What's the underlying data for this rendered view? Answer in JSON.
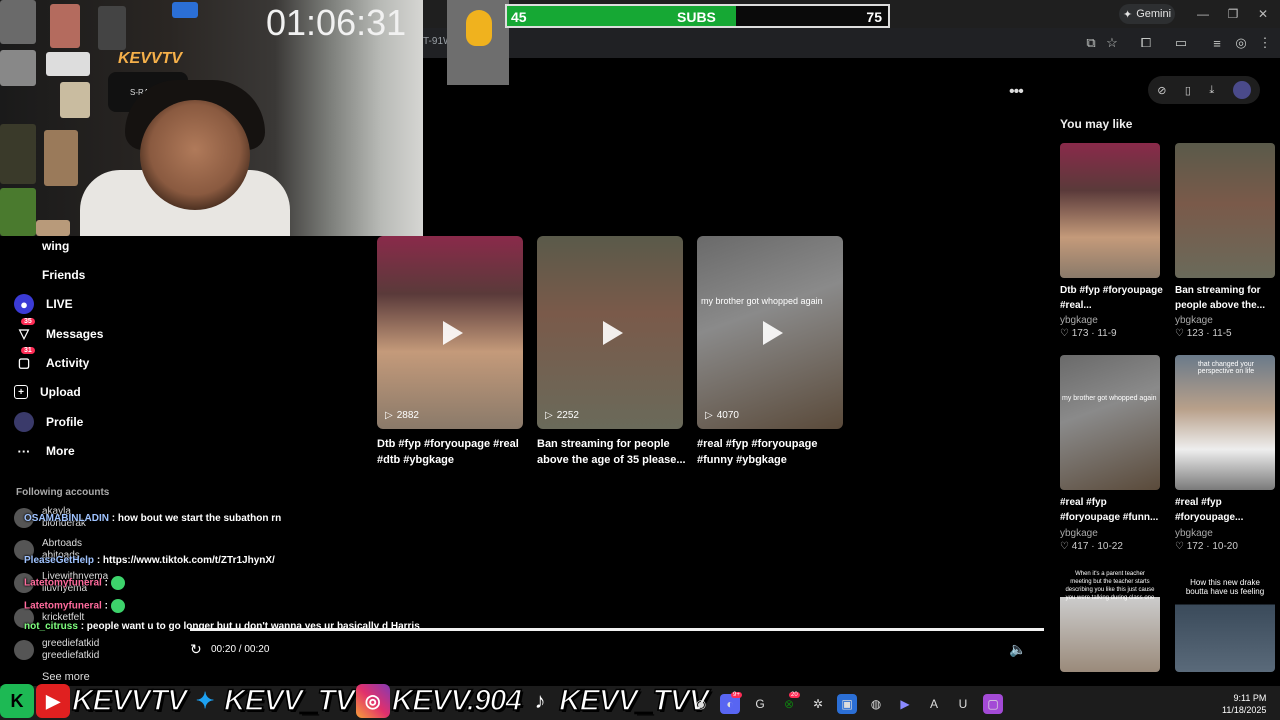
{
  "stream": {
    "timer": "01:06:31",
    "logo_text": "KEVVTV",
    "chair_text": "S-RACER",
    "subs_left": "45",
    "subs_label": "SUBS",
    "subs_right": "75",
    "subs_progress": 0.6
  },
  "browser": {
    "url_fragment": "T-91W",
    "gemini_label": "Gemini"
  },
  "nav": {
    "items": [
      {
        "label": "wing",
        "icon": "following-icon"
      },
      {
        "label": "Friends",
        "icon": "friends-icon"
      },
      {
        "label": "LIVE",
        "icon": "live-icon"
      },
      {
        "label": "Messages",
        "icon": "messages-icon",
        "badge": "35"
      },
      {
        "label": "Activity",
        "icon": "activity-icon",
        "badge": "31"
      },
      {
        "label": "Upload",
        "icon": "upload-icon"
      },
      {
        "label": "Profile",
        "icon": "profile-icon"
      },
      {
        "label": "More",
        "icon": "more-icon"
      }
    ],
    "following_header": "Following accounts",
    "accounts": [
      {
        "top": "akayla",
        "bottom": "blonderak"
      },
      {
        "top": "Abrtoads",
        "bottom": "abitoads"
      },
      {
        "top": "Livewithnyema",
        "bottom": "liuvnyema"
      },
      {
        "top": "kricketfelt",
        "bottom": "kricketfelt"
      },
      {
        "top": "greediefatkid",
        "bottom": "greediefatkid"
      }
    ],
    "see_more": "See more"
  },
  "chat": [
    {
      "user": "OSAMABINLADIN",
      "msg": ": how bout we start the subathon rn"
    },
    {
      "user": "PleaseGetHelp",
      "msg": ": https://www.tiktok.com/t/ZTr1JhynX/"
    },
    {
      "user": "Latetomyfuneral",
      "msg": ":"
    },
    {
      "user": "Latetomyfuneral",
      "msg": ":"
    },
    {
      "user": "not_citruss",
      "msg": ": people want u to go longer but u don't wanna yes ur basically d Harris"
    }
  ],
  "videos": [
    {
      "views": "2882",
      "title": "Dtb #fyp #foryoupage #real #dtb #ybgkage",
      "overlay": ""
    },
    {
      "views": "2252",
      "title": "Ban streaming for people above the age of 35 please...",
      "overlay": ""
    },
    {
      "views": "4070",
      "title": "#real #fyp #foryoupage #funny #ybgkage",
      "overlay": "my brother got whopped again"
    }
  ],
  "rail": {
    "header": "You may like",
    "items": [
      {
        "title": "Dtb #fyp #foryoupage #real...",
        "author": "ybgkage",
        "stats": "173 · 11-9"
      },
      {
        "title": "Ban streaming for people above the...",
        "author": "ybgkage",
        "stats": "123 · 11-5"
      },
      {
        "title": "#real #fyp #foryoupage #funn...",
        "author": "ybgkage",
        "stats": "417 · 10-22",
        "overlay": "my brother got whopped again"
      },
      {
        "title": "#real #fyp #foryoupage...",
        "author": "ybgkage",
        "stats": "172 · 10-20",
        "overlay": "that changed your perspective on life"
      },
      {
        "title": "",
        "author": "",
        "stats": "",
        "overlay": "When it's a parent teacher meeting but the teacher starts describing you like this just cause you were talking during class one"
      },
      {
        "title": "",
        "author": "",
        "stats": "",
        "overlay": "How this new drake boutta have us feeling"
      }
    ]
  },
  "player": {
    "time": "00:20 / 00:20",
    "progress": 1.0
  },
  "socials": {
    "youtube": "KEVVTV",
    "twitter": "KEVV_TV",
    "instagram": "KEVV.904",
    "tiktok": "KEVV_TVV"
  },
  "taskbar": {
    "time": "9:11 PM",
    "date": "11/18/2025",
    "discord_badge": "9+",
    "xbox_badge": "20"
  },
  "colors": {
    "subs_green": "#16a834",
    "tiktok_red": "#fe2c55",
    "bg": "#000000"
  }
}
